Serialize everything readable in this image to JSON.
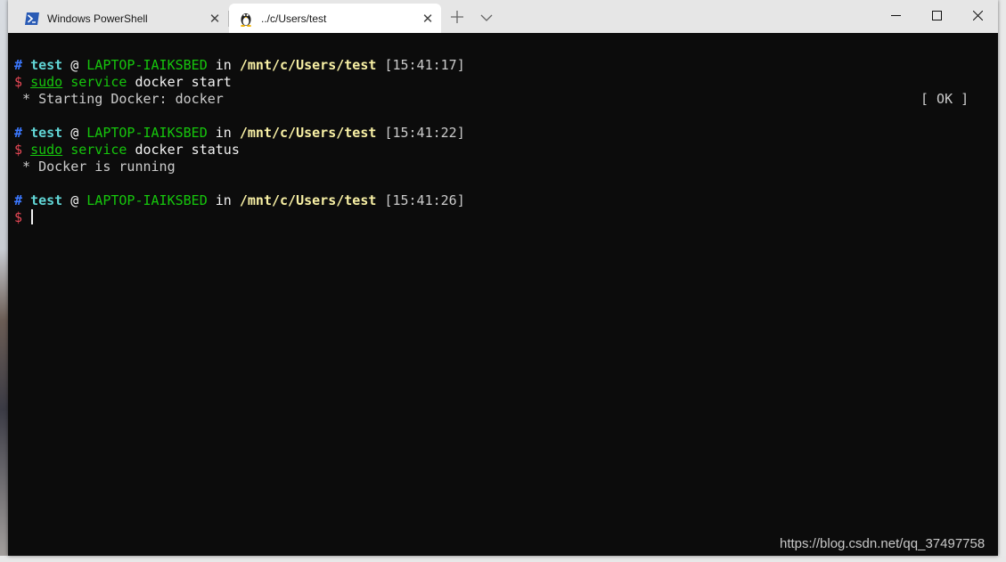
{
  "tabs": [
    {
      "label": "Windows PowerShell",
      "icon": "powershell-icon",
      "active": false
    },
    {
      "label": "../c/Users/test",
      "icon": "linux-penguin-icon",
      "active": true
    }
  ],
  "tab_controls": {
    "new_tab_icon": "plus-icon",
    "dropdown_icon": "chevron-down-icon"
  },
  "window_controls": {
    "minimize": "minimize-icon",
    "maximize": "maximize-icon",
    "close": "close-icon"
  },
  "terminal": {
    "prompts": [
      {
        "hash": "#",
        "user": "test",
        "at": "@",
        "host": "LAPTOP-IAIKSBED",
        "in": "in",
        "path": "/mnt/c/Users/test",
        "time": "[15:41:17]"
      },
      {
        "hash": "#",
        "user": "test",
        "at": "@",
        "host": "LAPTOP-IAIKSBED",
        "in": "in",
        "path": "/mnt/c/Users/test",
        "time": "[15:41:22]"
      },
      {
        "hash": "#",
        "user": "test",
        "at": "@",
        "host": "LAPTOP-IAIKSBED",
        "in": "in",
        "path": "/mnt/c/Users/test",
        "time": "[15:41:26]"
      }
    ],
    "commands": [
      {
        "dollar": "$",
        "sudo": "sudo",
        "service": "service",
        "args": "docker start"
      },
      {
        "dollar": "$",
        "sudo": "sudo",
        "service": "service",
        "args": "docker status"
      }
    ],
    "outputs": [
      {
        "text": " * Starting Docker: docker",
        "status": "[ OK ]"
      },
      {
        "text": " * Docker is running"
      }
    ],
    "final_prompt": "$"
  },
  "watermark": "https://blog.csdn.net/qq_37497758",
  "colors": {
    "background": "#0c0c0c",
    "user": "#3b78ff",
    "host": "#16c60c",
    "path": "#f9f1a5",
    "dollar": "#e74856",
    "sudo": "#16c60c"
  }
}
